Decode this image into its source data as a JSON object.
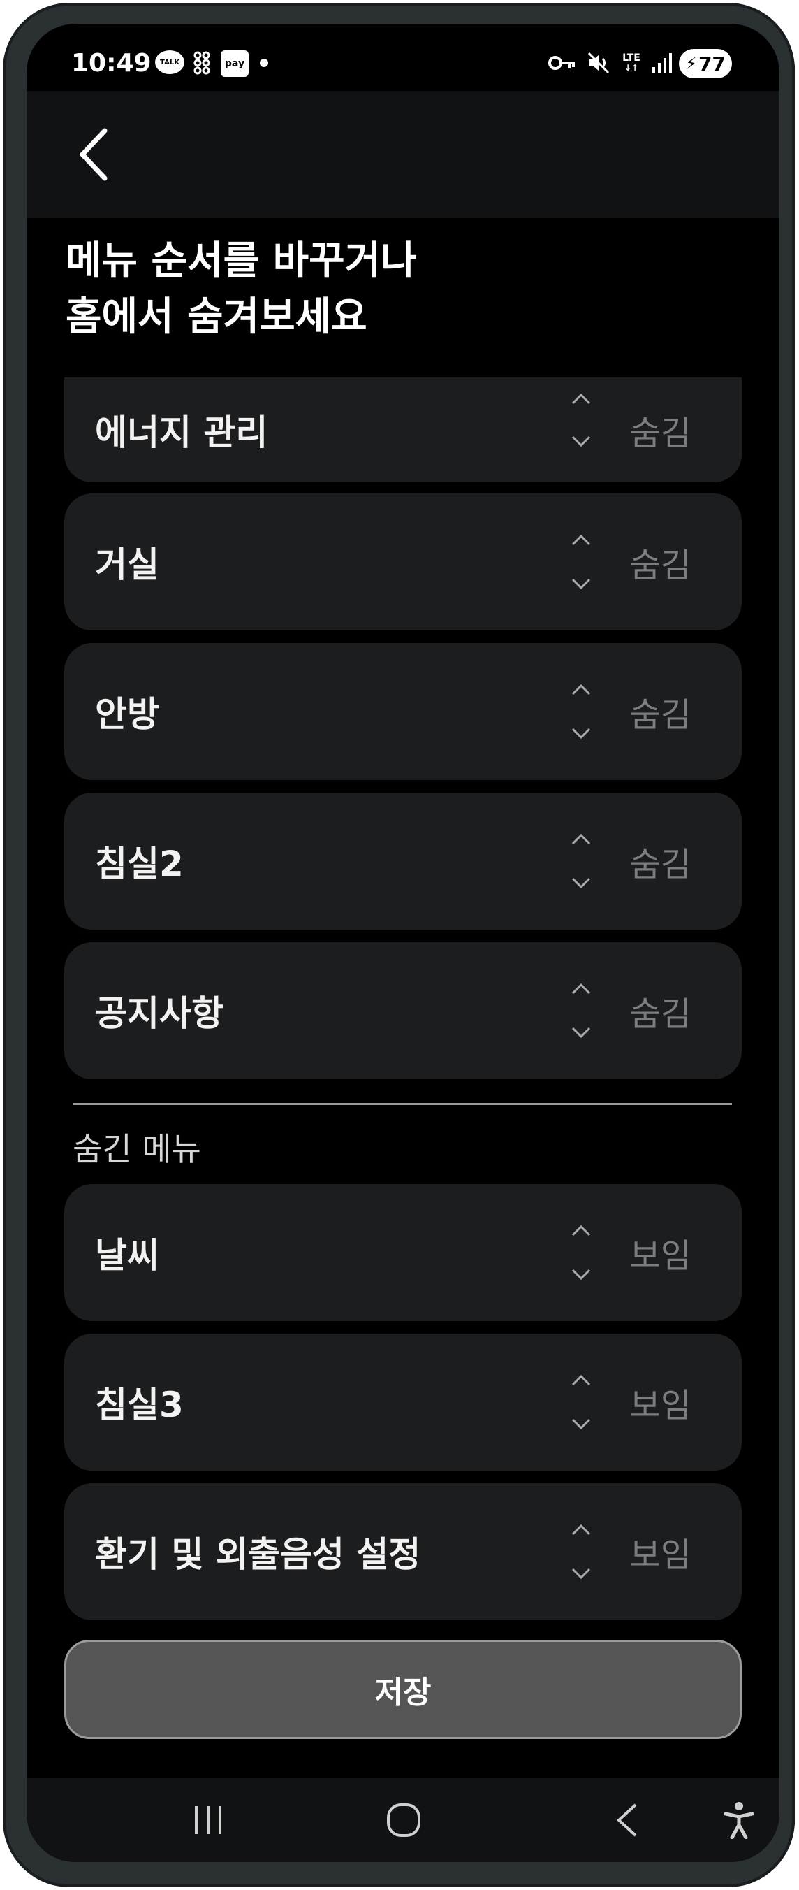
{
  "status_bar": {
    "time": "10:49",
    "talk_badge": "TALK",
    "pay_badge": "pay",
    "lte": "LTE",
    "battery": "77"
  },
  "page": {
    "title_line1": "메뉴 순서를 바꾸거나",
    "title_line2": "홈에서 숨겨보세요"
  },
  "visible_menus": [
    {
      "label": "에너지 관리",
      "action": "숨김"
    },
    {
      "label": "거실",
      "action": "숨김"
    },
    {
      "label": "안방",
      "action": "숨김"
    },
    {
      "label": "침실2",
      "action": "숨김"
    },
    {
      "label": "공지사항",
      "action": "숨김"
    }
  ],
  "hidden_section_label": "숨긴 메뉴",
  "hidden_menus": [
    {
      "label": "날씨",
      "action": "보임"
    },
    {
      "label": "침실3",
      "action": "보임"
    },
    {
      "label": "환기 및 외출음성 설정",
      "action": "보임"
    }
  ],
  "save_label": "저장",
  "colors": {
    "background": "#000000",
    "row_bg": "#1c1d1f",
    "action_text": "#7b7d80",
    "save_button": "#555555"
  },
  "icons": [
    "back-arrow-icon",
    "chevron-up-icon",
    "chevron-down-icon",
    "recents-icon",
    "home-icon",
    "nav-back-icon",
    "accessibility-icon"
  ]
}
